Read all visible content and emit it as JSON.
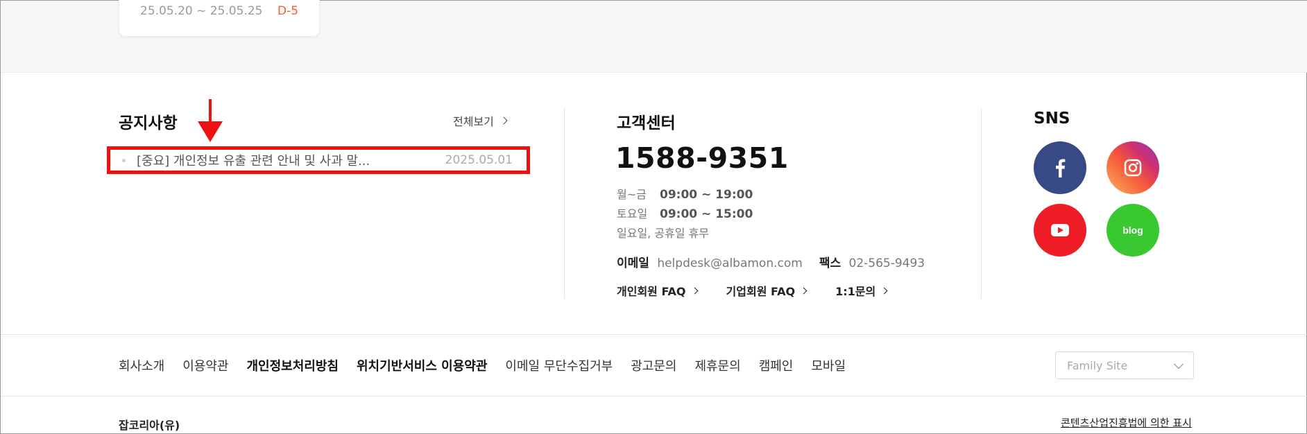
{
  "recruit_card": {
    "period": "25.05.20 ~ 25.05.25",
    "dday": "D-5"
  },
  "notice": {
    "title": "공지사항",
    "view_all": "전체보기",
    "items": [
      {
        "text": "[중요] 개인정보 유출 관련 안내 및 사과 말...",
        "date": "2025.05.01"
      }
    ]
  },
  "customer_center": {
    "title": "고객센터",
    "phone": "1588-9351",
    "hours": [
      {
        "day": "월~금",
        "time": "09:00 ~ 19:00"
      },
      {
        "day": "토요일",
        "time": "09:00 ~ 15:00"
      }
    ],
    "holiday_note": "일요일, 공휴일 휴무",
    "email_label": "이메일",
    "email": "helpdesk@albamon.com",
    "fax_label": "팩스",
    "fax": "02-565-9493",
    "links": [
      "개인회원 FAQ",
      "기업회원 FAQ",
      "1:1문의"
    ]
  },
  "sns": {
    "title": "SNS",
    "icons": [
      "facebook-icon",
      "instagram-icon",
      "youtube-icon",
      "blog-icon"
    ],
    "blog_text": "blog"
  },
  "footer": {
    "links": [
      "회사소개",
      "이용약관",
      "개인정보처리방침",
      "위치기반서비스 이용약관",
      "이메일 무단수집거부",
      "광고문의",
      "제휴문의",
      "캠페인",
      "모바일"
    ],
    "family_site_placeholder": "Family Site",
    "company": "잡코리아(유)",
    "contents_law": "콘텐츠산업진흥법에 의한 표시"
  },
  "colors": {
    "highlight": "#ee1111",
    "dday": "#ff5a2c",
    "facebook": "#374a86",
    "youtube": "#ee1c25",
    "blog": "#3ac831"
  }
}
